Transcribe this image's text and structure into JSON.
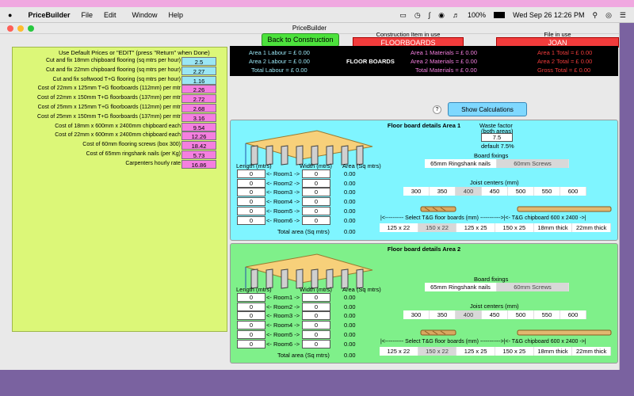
{
  "menubar": {
    "app": "PriceBuilder",
    "items": [
      "File",
      "Edit",
      "Window",
      "Help"
    ],
    "battery": "100%",
    "datetime": "Wed Sep 26  12:26 PM"
  },
  "window": {
    "title": "PriceBuilder"
  },
  "header": {
    "back_button": "Back to Construction",
    "construction_label": "Construction Item in use",
    "construction_value": "FLOORBOARDS",
    "file_label": "File in use",
    "file_value": "JOAN"
  },
  "prices": {
    "header": "Use Default Prices or     \"EDIT\"   (press \"Return\" when Done)",
    "rows": [
      {
        "label": "Cut and fix 18mm chipboard flooring (sq mtrs per hour)",
        "value": "2.5",
        "color": "blue"
      },
      {
        "label": "Cut and fix 22mm chipboard flooring (sq mtrs per hour)",
        "value": "2.27",
        "color": "blue"
      },
      {
        "label": "Cut and fix softwood T+G flooring (sq mtrs per hour)",
        "value": "1.16",
        "color": "blue"
      },
      {
        "label": "Cost of 22mm x 125mm T+G floorboards (112mm) per mtr",
        "value": "2.26",
        "color": "pink"
      },
      {
        "label": "Cost of 22mm x 150mm T+G floorboards (137mm) per mtr",
        "value": "2.72",
        "color": "pink"
      },
      {
        "label": "Cost of 25mm x 125mm T+G floorboards (112mm) per mtr",
        "value": "2.68",
        "color": "pink"
      },
      {
        "label": "Cost of 25mm x 150mm T+G floorboards (137mm) per mtr",
        "value": "3.16",
        "color": "pink"
      },
      {
        "label": "Cost of 18mm x 600mm x 2400mm chipboard each",
        "value": "9.54",
        "color": "pink"
      },
      {
        "label": "Cost of 22mm x 600mm x 2400mm chipboard each",
        "value": "12.26",
        "color": "pink"
      },
      {
        "label": "Cost of 60mm flooring screws (box 300)",
        "value": "18.42",
        "color": "pink"
      },
      {
        "label": "Cost of 65mm ringshank nails (per Kg)",
        "value": "5.73",
        "color": "pink"
      },
      {
        "label": "Carpenters hourly rate",
        "value": "16.86",
        "color": "pink"
      }
    ]
  },
  "summary": {
    "area1_labour": "Area 1 Labour = £   0.00",
    "area2_labour": "Area 2 Labour = £   0.00",
    "total_labour": "Total Labour  = £   0.00",
    "title": "FLOOR BOARDS",
    "area1_materials": "Area 1 Materials = £ 0.00",
    "area2_materials": "Area 2 Materials = £ 0.00",
    "total_materials": "Total Materials = £ 0.00",
    "area1_total": "Area 1 Total = £  0.00",
    "area2_total": "Area 2 Total = £  0.00",
    "gross_total": "Gross Total = £  0.00"
  },
  "help": "?",
  "show_calc": "Show Calculations",
  "area1": {
    "title": "Floor board details Area 1",
    "waste_label": "Waste factor",
    "waste_sub": "(both areas)",
    "waste_value": "7.5",
    "waste_default": "default 7.5%",
    "length_label": "Length (mtrs)",
    "width_label": "Width (mtrs)",
    "area_label": "Area (Sq mtrs)",
    "rooms": [
      {
        "name": "<- Room1 ->",
        "len": "0",
        "wid": "0",
        "area": "0.00"
      },
      {
        "name": "<- Room2 ->",
        "len": "0",
        "wid": "0",
        "area": "0.00"
      },
      {
        "name": "<- Room3 ->",
        "len": "0",
        "wid": "0",
        "area": "0.00"
      },
      {
        "name": "<- Room4 ->",
        "len": "0",
        "wid": "0",
        "area": "0.00"
      },
      {
        "name": "<- Room5 ->",
        "len": "0",
        "wid": "0",
        "area": "0.00"
      },
      {
        "name": "<- Room6 ->",
        "len": "0",
        "wid": "0",
        "area": "0.00"
      }
    ],
    "total_label": "Total area (Sq mtrs)",
    "total_value": "0.00",
    "fixings_label": "Board fixings",
    "fixings": [
      "65mm Ringshank nails",
      "60mm Screws"
    ],
    "joist_label": "Joist centers (mm)",
    "joists": [
      "300",
      "350",
      "400",
      "450",
      "500",
      "550",
      "600"
    ],
    "select_label": "|<---------- Select T&G floor boards (mm) ----------->|<- T&G chipboard 600 x 2400 ->|",
    "boards": [
      "125 x 22",
      "150 x 22",
      "125 x 25",
      "150 x 25",
      "18mm thick",
      "22mm thick"
    ]
  },
  "area2": {
    "title": "Floor board details Area 2",
    "length_label": "Length (mtrs)",
    "width_label": "Width (mtrs)",
    "area_label": "Area (Sq mtrs)",
    "rooms": [
      {
        "name": "<- Room1 ->",
        "len": "0",
        "wid": "0",
        "area": "0.00"
      },
      {
        "name": "<- Room2 ->",
        "len": "0",
        "wid": "0",
        "area": "0.00"
      },
      {
        "name": "<- Room3 ->",
        "len": "0",
        "wid": "0",
        "area": "0.00"
      },
      {
        "name": "<- Room4 ->",
        "len": "0",
        "wid": "0",
        "area": "0.00"
      },
      {
        "name": "<- Room5 ->",
        "len": "0",
        "wid": "0",
        "area": "0.00"
      },
      {
        "name": "<- Room6 ->",
        "len": "0",
        "wid": "0",
        "area": "0.00"
      }
    ],
    "total_label": "Total area (Sq mtrs)",
    "total_value": "0.00",
    "fixings_label": "Board fixings",
    "fixings": [
      "65mm Ringshank nails",
      "60mm Screws"
    ],
    "joist_label": "Joist centers (mm)",
    "joists": [
      "300",
      "350",
      "400",
      "450",
      "500",
      "550",
      "600"
    ],
    "select_label": "|<---------- Select T&G floor boards (mm) ----------->|<- T&G chipboard 600 x 2400 ->|",
    "boards": [
      "125 x 22",
      "150 x 22",
      "125 x 25",
      "150 x 25",
      "18mm thick",
      "22mm thick"
    ]
  },
  "colors": {
    "cyan_panel": "#7ff5ff",
    "green_panel": "#7ff08a",
    "left_panel": "#dcf778",
    "red": "#f23c3c",
    "labour": "#9ae6f4",
    "materials": "#f57fe0",
    "totals": "#f23c3c"
  }
}
